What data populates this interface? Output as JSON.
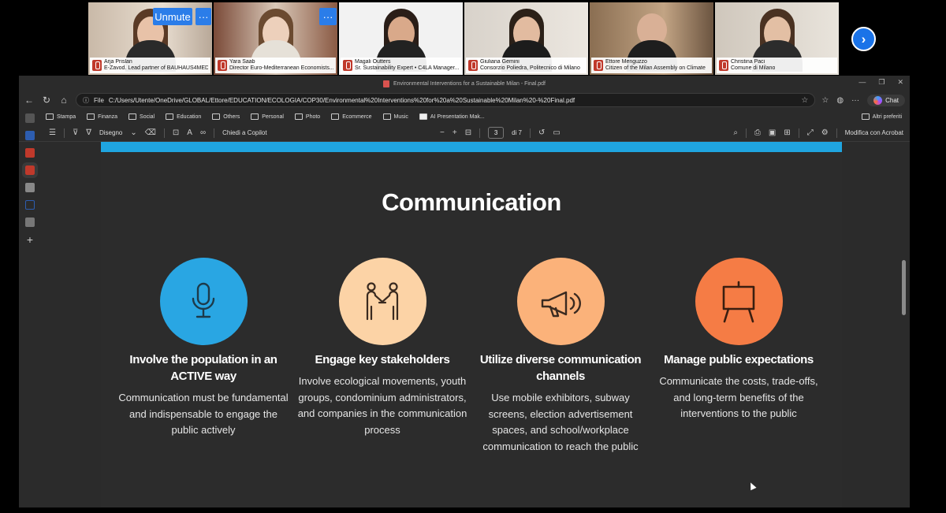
{
  "meeting": {
    "unmute_label": "Unmute",
    "more_label": "···",
    "participants": [
      {
        "name": "Arja Prislan",
        "role": "E-Zavod. Lead partner of BAUHAUS4MED"
      },
      {
        "name": "Yara Saab",
        "role": "Director Euro-Mediterranean  Economists..."
      },
      {
        "name": "Magali Outters",
        "role": "Sr. Sustainability Expert • C4LA Manager..."
      },
      {
        "name": "Giuliana Gemini",
        "role": "Consorzio Poliedra, Politecnico di Milano"
      },
      {
        "name": "Ettore Menguzzo",
        "role": "Citizen of the Milan Assembly on Climate"
      },
      {
        "name": "Christina Paci",
        "role": "Comune di Milano"
      }
    ],
    "next_icon": "chevron-right-icon"
  },
  "browser": {
    "doc_title": "Environmental Interventions for a Sustainable Milan - Final.pdf",
    "file_label": "File",
    "url": "C:/Users/Utente/OneDrive/GLOBAL/Ettore/EDUCATION/ECOLOGIA/COP30/Environmental%20Interventions%20for%20a%20Sustainable%20Milan%20-%20Final.pdf",
    "chat_label": "Chat",
    "bookmarks": [
      "Stampa",
      "Finanza",
      "Social",
      "Education",
      "Others",
      "Personal",
      "Photo",
      "Ecommerce",
      "Music",
      "AI Presentation Mak..."
    ],
    "other_bookmarks": "Altri preferiti"
  },
  "pdf_toolbar": {
    "draw_label": "Disegno",
    "copilot_label": "Chiedi a Copilot",
    "page_current": "3",
    "page_total": "di 7",
    "edit_acrobat": "Modifica con Acrobat"
  },
  "slide": {
    "title": "Communication",
    "columns": [
      {
        "icon": "microphone-icon",
        "color": "#29a6e3",
        "title": "Involve the population in an ACTIVE way",
        "text": "Communication must be fundamental and indispensable to engage the public actively"
      },
      {
        "icon": "handshake-people-icon",
        "color": "#fcd3a6",
        "title": "Engage key stakeholders",
        "text": "Involve ecological movements, youth groups, condominium administrators, and companies in the communication process"
      },
      {
        "icon": "megaphone-icon",
        "color": "#fbb27a",
        "title": "Utilize diverse communication channels",
        "text": "Use mobile exhibitors, subway screens, election advertisement spaces, and school/workplace communication to reach the public"
      },
      {
        "icon": "presentation-board-icon",
        "color": "#f57c45",
        "title": "Manage public expectations",
        "text": "Communicate the costs, trade-offs, and long-term benefits of the interventions to the public"
      }
    ]
  }
}
